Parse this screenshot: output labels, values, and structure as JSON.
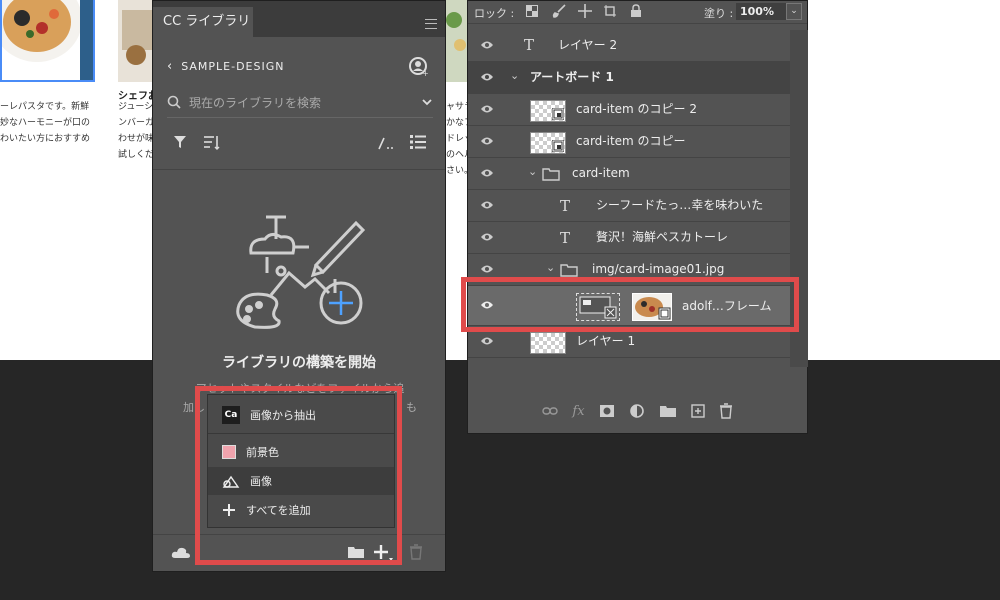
{
  "canvas": {
    "card1": {
      "text_lines": [
        "ーレパスタです。新鮮",
        "妙なハーモニーが口の",
        "わいたい方におすすめ"
      ]
    },
    "card2": {
      "title": "シェフお",
      "text_lines": [
        "ジューシ",
        "ンバーガ",
        "わせが味",
        "試しくだ"
      ]
    },
    "card3": {
      "text_lines": [
        "ャサラ",
        "かなフ",
        "ドレッ",
        "のヘル",
        "さい。"
      ]
    }
  },
  "cc_libraries": {
    "tab_label": "CC ライブラリ",
    "library_name": "SAMPLE-DESIGN",
    "search_placeholder": "現在のライブラリを検索",
    "empty_title": "ライブラリの構築を開始",
    "empty_desc_line1": "アセットやスタイルなどをファイルから追",
    "empty_desc_line2": "加し",
    "empty_desc_tail": "も"
  },
  "add_menu": {
    "items": [
      {
        "label": "画像から抽出",
        "icon": "ca-app-icon"
      },
      {
        "label": "前景色",
        "icon": "color-swatch"
      },
      {
        "label": "画像",
        "icon": "image-icon"
      },
      {
        "label": "すべてを追加",
        "icon": "plus-icon"
      }
    ],
    "ca_icon_text": "Ca",
    "swatch_color": "#f0a3ad"
  },
  "layers": {
    "lock_label": "ロック :",
    "fill_label": "塗り :",
    "fill_value": "100%",
    "rows": [
      {
        "name": "レイヤー 2",
        "kind": "text"
      },
      {
        "name": "アートボード 1",
        "kind": "artboard"
      },
      {
        "name": "card-item のコピー 2",
        "kind": "smart"
      },
      {
        "name": "card-item のコピー",
        "kind": "smart"
      },
      {
        "name": "card-item",
        "kind": "group"
      },
      {
        "name": "シーフードたっ…幸を味わいた",
        "kind": "text"
      },
      {
        "name": "贅沢！海鮮ペスカトーレ",
        "kind": "text"
      },
      {
        "name": "img/card-image01.jpg",
        "kind": "group"
      },
      {
        "name": "adolf…フレーム",
        "kind": "frame",
        "selected": true
      },
      {
        "name": "レイヤー 1",
        "kind": "pixel"
      }
    ]
  },
  "colors": {
    "highlight_red": "#e04b4b",
    "panel_bg": "#535353"
  }
}
